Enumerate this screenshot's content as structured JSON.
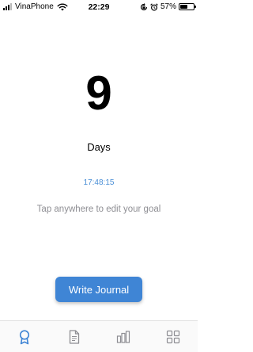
{
  "status_bar": {
    "carrier": "VinaPhone",
    "time": "22:29",
    "battery_percent": "57%",
    "battery_level": 0.57,
    "icons": [
      "signal-icon",
      "wifi-icon",
      "rotation-lock-icon",
      "alarm-icon",
      "battery-icon"
    ]
  },
  "streak": {
    "count": "9",
    "unit": "Days",
    "timer": "17:48:15",
    "hint": "Tap anywhere to edit your goal"
  },
  "actions": {
    "write_journal_label": "Write Journal"
  },
  "tab_bar": {
    "tabs": [
      {
        "icon": "badge-icon",
        "active": true
      },
      {
        "icon": "document-icon",
        "active": false
      },
      {
        "icon": "bar-chart-icon",
        "active": false
      },
      {
        "icon": "grid-icon",
        "active": false
      }
    ]
  },
  "colors": {
    "accent": "#3f85d5",
    "timer_text": "#4a8fd6",
    "hint_text": "#8e8e93",
    "inactive_icon": "#8e8e93"
  }
}
